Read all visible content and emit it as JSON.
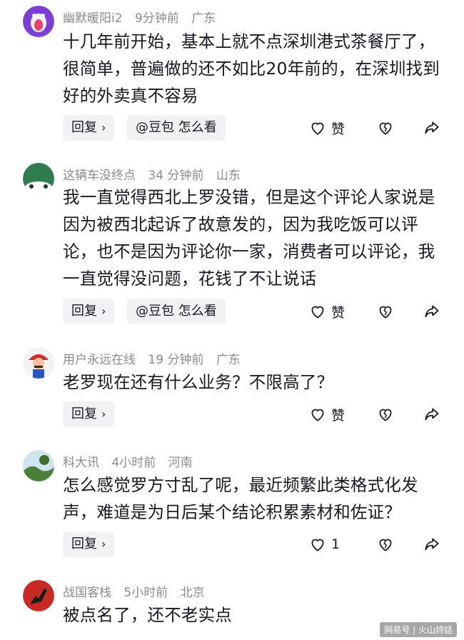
{
  "comments": [
    {
      "username": "幽默暖阳i2",
      "time": "9分钟前",
      "location": "广东",
      "text": "十几年前开始，基本上就不点深圳港式茶餐厅了，很简单，普遍做的还不如比20年前的，在深圳找到好的外卖真不容易",
      "reply_label": "回复",
      "ask_label": "@豆包 怎么看",
      "like_label": "赞"
    },
    {
      "username": "这辆车没终点",
      "time": "34 分钟前",
      "location": "山东",
      "text": "我一直觉得西北上罗没错，但是这个评论人家说是因为被西北起诉了故意发的，因为我吃饭可以评论，也不是因为评论你一家，消费者可以评论，我一直觉得没问题，花钱了不让说话",
      "reply_label": "回复",
      "ask_label": "@豆包 怎么看",
      "like_label": "赞"
    },
    {
      "username": "用户永远在线",
      "time": "19 分钟前",
      "location": "广东",
      "text": "老罗现在还有什么业务？不限高了？",
      "reply_label": "回复",
      "like_label": "赞"
    },
    {
      "username": "科大讯",
      "time": "4小时前",
      "location": "河南",
      "text": "怎么感觉罗方寸乱了呢，最近频繁此类格式化发声，难道是为日后某个结论积累素材和佐证？",
      "reply_label": "回复",
      "like_label": "1"
    },
    {
      "username": "战国客栈",
      "time": "5小时前",
      "location": "北京",
      "text": "被点名了，还不老实点"
    }
  ],
  "watermark": "网易号 | 火山詩話",
  "icons": {
    "like": "heart-outline-icon",
    "dislike": "broken-heart-icon",
    "share": "share-arrow-icon",
    "chevron": "chevron-right-icon"
  }
}
